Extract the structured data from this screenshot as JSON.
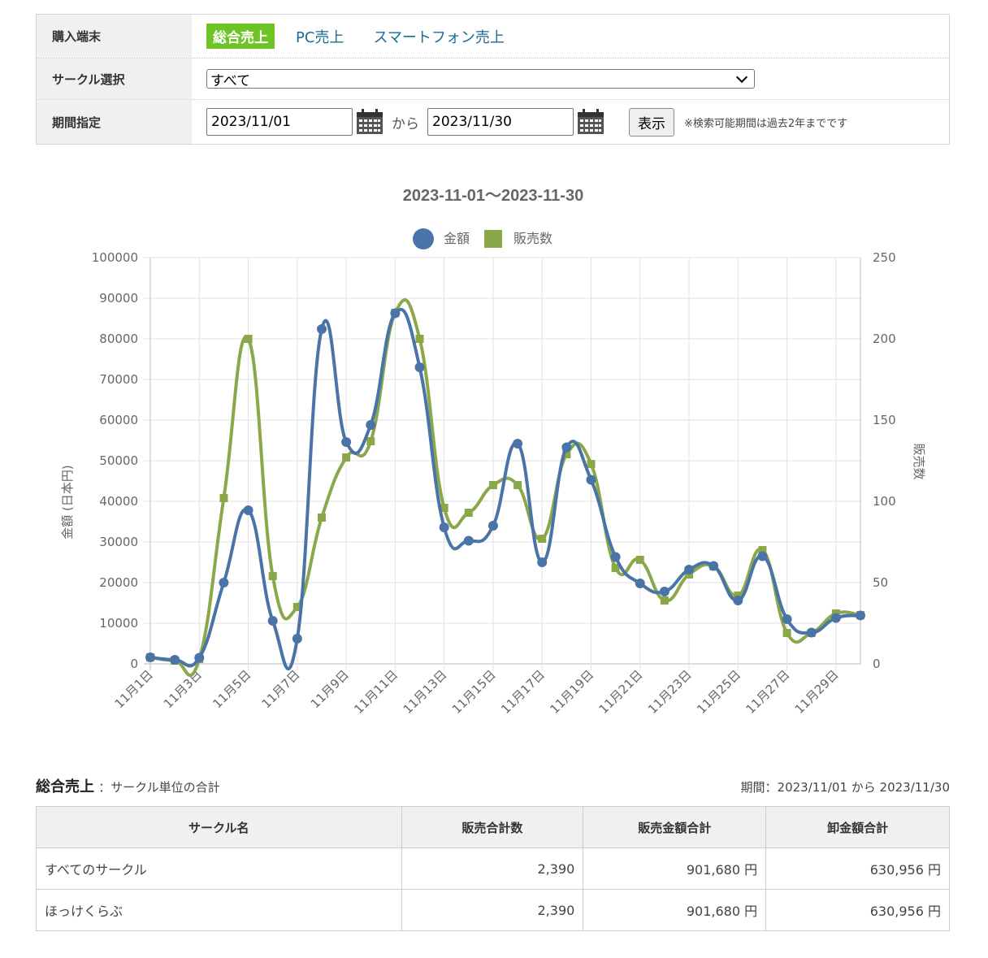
{
  "filter": {
    "device_label": "購入端末",
    "tabs": [
      {
        "label": "総合売上",
        "active": true
      },
      {
        "label": "PC売上",
        "active": false
      },
      {
        "label": "スマートフォン売上",
        "active": false
      }
    ],
    "circle_label": "サークル選択",
    "circle_selected": "すべて",
    "period_label": "期間指定",
    "date_from": "2023/11/01",
    "date_sep": "から",
    "date_to": "2023/11/30",
    "show_button": "表示",
    "note": "※検索可能期間は過去2年までです"
  },
  "chart_data": {
    "type": "line",
    "title": "2023-11-01～2023-11-30",
    "categories": [
      "11月1日",
      "11月2日",
      "11月3日",
      "11月4日",
      "11月5日",
      "11月6日",
      "11月7日",
      "11月8日",
      "11月9日",
      "11月10日",
      "11月11日",
      "11月12日",
      "11月13日",
      "11月14日",
      "11月15日",
      "11月16日",
      "11月17日",
      "11月18日",
      "11月19日",
      "11月20日",
      "11月21日",
      "11月22日",
      "11月23日",
      "11月24日",
      "11月25日",
      "11月26日",
      "11月27日",
      "11月28日",
      "11月29日",
      "11月30日"
    ],
    "tick_labels": [
      "11月1日",
      "11月3日",
      "11月5日",
      "11月7日",
      "11月9日",
      "11月11日",
      "11月13日",
      "11月15日",
      "11月17日",
      "11月19日",
      "11月21日",
      "11月23日",
      "11月25日",
      "11月27日",
      "11月29日"
    ],
    "series": [
      {
        "name": "金額",
        "axis": "left",
        "color": "#4a74a8",
        "marker": "circle",
        "values": [
          1600,
          1000,
          1500,
          20000,
          37800,
          10600,
          6200,
          82400,
          54600,
          58800,
          86300,
          73000,
          33600,
          30300,
          34000,
          54200,
          25000,
          53300,
          45300,
          26300,
          19800,
          17800,
          23200,
          24100,
          15600,
          26500,
          11000,
          7700,
          11300,
          11900
        ]
      },
      {
        "name": "販売数",
        "axis": "right",
        "color": "#8aa84a",
        "marker": "square",
        "values": [
          4,
          2,
          3,
          102,
          200,
          54,
          35,
          90,
          127,
          137,
          216,
          200,
          96,
          93,
          110,
          110,
          77,
          129,
          123,
          59,
          64,
          39,
          55,
          60,
          42,
          70,
          19,
          19,
          31,
          30
        ]
      }
    ],
    "ylabel": "金額 (日本円)",
    "ylabel_right": "販売数",
    "ylim": [
      0,
      100000
    ],
    "ylim_right": [
      0,
      250
    ],
    "yticks": [
      0,
      10000,
      20000,
      30000,
      40000,
      50000,
      60000,
      70000,
      80000,
      90000,
      100000
    ],
    "yticks_right": [
      0,
      50,
      100,
      150,
      200,
      250
    ],
    "legend": "top",
    "grid": true
  },
  "summary": {
    "title": "総合売上",
    "subtitle": "：サークル単位の合計",
    "period": "期間：2023/11/01 から 2023/11/30",
    "columns": [
      "サークル名",
      "販売合計数",
      "販売金額合計",
      "卸金額合計"
    ],
    "rows": [
      {
        "name": "すべてのサークル",
        "count": "2,390",
        "sales": "901,680 円",
        "wholesale": "630,956 円"
      },
      {
        "name": "ほっけくらぶ",
        "count": "2,390",
        "sales": "901,680 円",
        "wholesale": "630,956 円"
      }
    ]
  }
}
